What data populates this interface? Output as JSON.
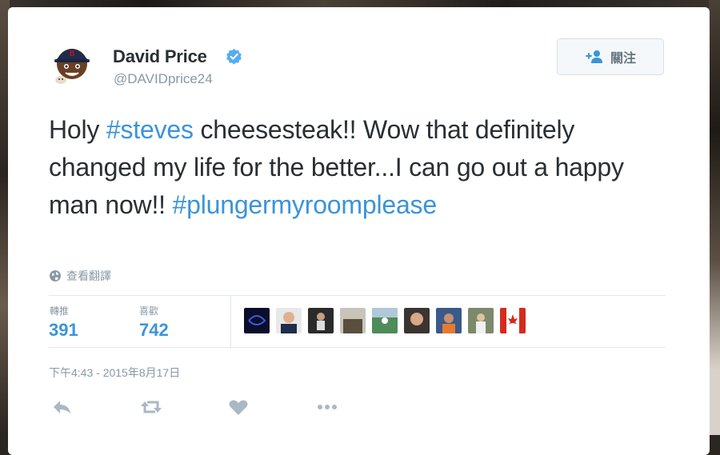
{
  "author": {
    "name": "David Price",
    "handle": "@DAVIDprice24",
    "avatar_icon": "bitmoji-avatar-red-sox-cap"
  },
  "follow_button": {
    "label": "關注",
    "icon": "add-user-icon"
  },
  "tweet": {
    "segments": [
      {
        "text": "Holy ",
        "type": "text"
      },
      {
        "text": "#steves",
        "type": "hashtag"
      },
      {
        "text": " cheesesteak!! Wow that definitely changed my life for the better...I can go out a happy man now!! ",
        "type": "text"
      },
      {
        "text": "#plungermyroomplease",
        "type": "hashtag"
      }
    ]
  },
  "translate": {
    "label": "查看翻譯",
    "icon": "globe-icon"
  },
  "stats": {
    "retweets_label": "轉推",
    "retweets_value": "391",
    "likes_label": "喜歡",
    "likes_value": "742"
  },
  "likers_count_shown": 9,
  "timestamp": "下午4:43 - 2015年8月17日",
  "actions": {
    "reply_icon": "reply-icon",
    "retweet_icon": "retweet-icon",
    "like_icon": "heart-icon",
    "more_icon": "more-icon"
  },
  "colors": {
    "link": "#3b94d9",
    "text": "#292f33",
    "muted": "#8899a6",
    "verified": "#55acee"
  }
}
